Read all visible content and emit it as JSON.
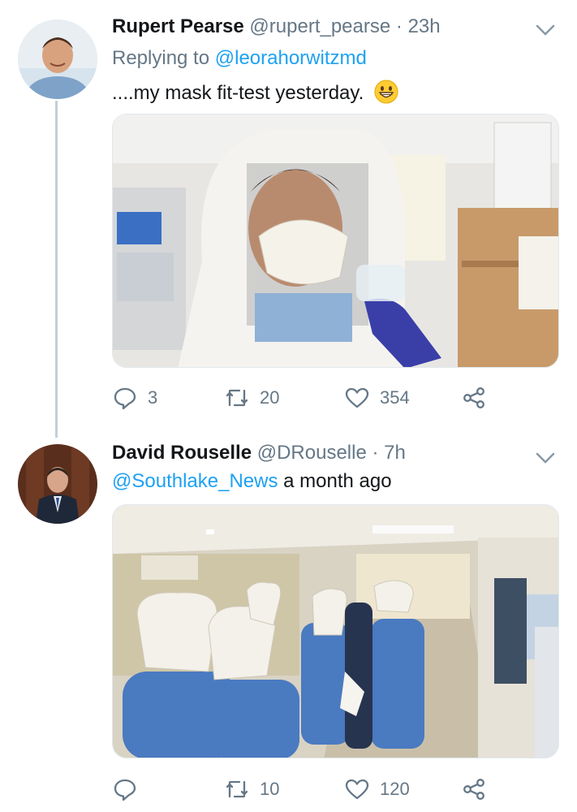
{
  "tweets": [
    {
      "name": "Rupert Pearse",
      "handle": "@rupert_pearse",
      "separator": "·",
      "time": "23h",
      "replying_prefix": "Replying to",
      "replying_to": "@leorahorwitzmd",
      "text": "....my mask fit-test yesterday.",
      "emoji": "grinning-face-emoji",
      "stats": {
        "replies": "3",
        "retweets": "20",
        "likes": "354"
      }
    },
    {
      "name": "David Rouselle",
      "handle": "@DRouselle",
      "separator": "·",
      "time": "7h",
      "mention": "@Southlake_News",
      "text": " a month ago",
      "stats": {
        "replies": "",
        "retweets": "10",
        "likes": "120"
      }
    }
  ],
  "icons": [
    "reply-icon",
    "retweet-icon",
    "like-icon",
    "share-icon",
    "chevron-down-icon"
  ],
  "colors": {
    "link": "#1da1f2",
    "secondary": "#657786",
    "text": "#14171a",
    "thread": "#c4cfd6"
  }
}
